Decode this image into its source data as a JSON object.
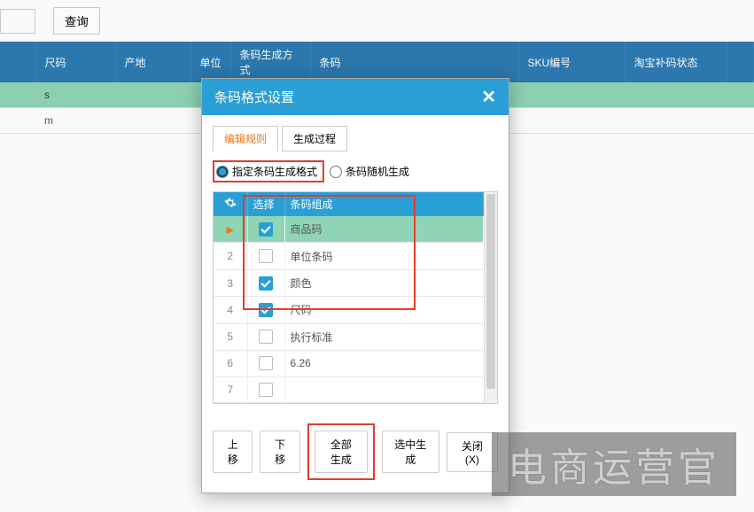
{
  "top": {
    "input_value": "",
    "query_label": "查询"
  },
  "table": {
    "headers": [
      "",
      "尺码",
      "产地",
      "单位",
      "条码生成方式",
      "条码",
      "SKU编号",
      "淘宝补码状态",
      ""
    ],
    "rows": [
      {
        "size": "s"
      },
      {
        "size": "m"
      }
    ]
  },
  "modal": {
    "title": "条码格式设置",
    "close_char": "✕",
    "tabs": {
      "edit_rule": "编辑规则",
      "gen_process": "生成过程"
    },
    "radio": {
      "format": "指定条码生成格式",
      "random": "条码随机生成"
    },
    "inner_headers": {
      "sel": "选择",
      "comp": "条码组成"
    },
    "items": [
      {
        "idx": "",
        "checked": true,
        "label": "商品码",
        "hl": true,
        "arrow": true
      },
      {
        "idx": "2",
        "checked": false,
        "label": "单位条码"
      },
      {
        "idx": "3",
        "checked": true,
        "label": "颜色"
      },
      {
        "idx": "4",
        "checked": true,
        "label": "尺码"
      },
      {
        "idx": "5",
        "checked": false,
        "label": "执行标准"
      },
      {
        "idx": "6",
        "checked": false,
        "label": "6.26"
      },
      {
        "idx": "7",
        "checked": false,
        "label": ""
      }
    ],
    "footer": {
      "up": "上移",
      "down": "下移",
      "gen_all": "全部生成",
      "gen_sel": "选中生成",
      "close": "关闭(X)"
    }
  },
  "watermark": "电商运营官"
}
